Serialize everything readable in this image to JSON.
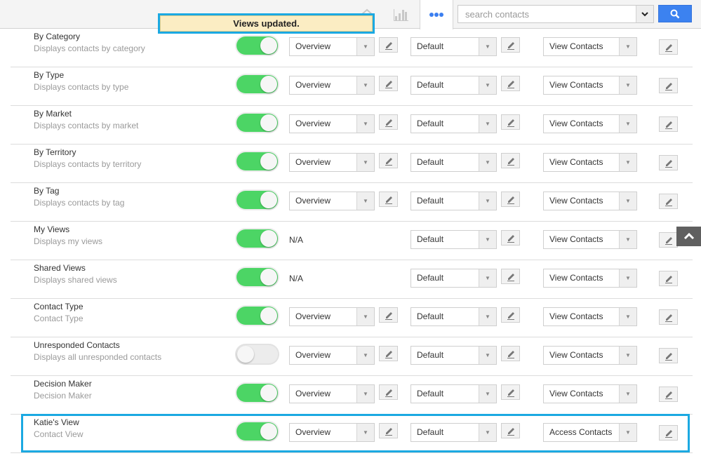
{
  "topbar": {
    "icons": [
      "home-icon",
      "chart-icon",
      "more-icon"
    ],
    "search": {
      "placeholder": "search contacts",
      "value": ""
    }
  },
  "toast": {
    "message": "Views updated."
  },
  "rows": [
    {
      "name": "By Category",
      "description": "Displays contacts by category",
      "enabled": true,
      "layout": "Overview",
      "theme": "Default",
      "permission": "View Contacts"
    },
    {
      "name": "By Type",
      "description": "Displays contacts by type",
      "enabled": true,
      "layout": "Overview",
      "theme": "Default",
      "permission": "View Contacts"
    },
    {
      "name": "By Market",
      "description": "Displays contacts by market",
      "enabled": true,
      "layout": "Overview",
      "theme": "Default",
      "permission": "View Contacts"
    },
    {
      "name": "By Territory",
      "description": "Displays contacts by territory",
      "enabled": true,
      "layout": "Overview",
      "theme": "Default",
      "permission": "View Contacts"
    },
    {
      "name": "By Tag",
      "description": "Displays contacts by tag",
      "enabled": true,
      "layout": "Overview",
      "theme": "Default",
      "permission": "View Contacts"
    },
    {
      "name": "My Views",
      "description": "Displays my views",
      "enabled": true,
      "layout": "N/A",
      "theme": "Default",
      "permission": "View Contacts"
    },
    {
      "name": "Shared Views",
      "description": "Displays shared views",
      "enabled": true,
      "layout": "N/A",
      "theme": "Default",
      "permission": "View Contacts"
    },
    {
      "name": "Contact Type",
      "description": "Contact Type",
      "enabled": true,
      "layout": "Overview",
      "theme": "Default",
      "permission": "View Contacts"
    },
    {
      "name": "Unresponded Contacts",
      "description": "Displays all unresponded contacts",
      "enabled": false,
      "layout": "Overview",
      "theme": "Default",
      "permission": "View Contacts"
    },
    {
      "name": "Decision Maker",
      "description": "Decision Maker",
      "enabled": true,
      "layout": "Overview",
      "theme": "Default",
      "permission": "View Contacts"
    },
    {
      "name": "Katie's View",
      "description": "Contact View",
      "enabled": true,
      "layout": "Overview",
      "theme": "Default",
      "permission": "Access Contacts"
    }
  ],
  "colors": {
    "accent": "#3c82f0",
    "highlight": "#1ba9e2",
    "toggle_on": "#4cd565",
    "toast_bg": "#fbedc3"
  }
}
